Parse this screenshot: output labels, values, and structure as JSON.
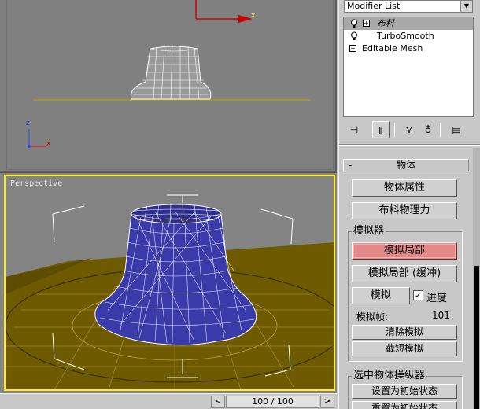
{
  "viewports": {
    "perspective_label": "Perspective",
    "axis_z": "z",
    "axis_x": "x"
  },
  "bottom_bar": {
    "frame_counter": "100 / 100",
    "prev_icon": "<",
    "next_icon": ">"
  },
  "modifier_panel": {
    "modifier_list_label": "Modifier List",
    "stack": [
      {
        "label": "布料",
        "has_bulb": true,
        "has_plus": true,
        "selected": true
      },
      {
        "label": "TurboSmooth",
        "has_bulb": true,
        "has_plus": false,
        "selected": false
      },
      {
        "label": "Editable Mesh",
        "has_bulb": false,
        "has_plus": true,
        "selected": false
      }
    ],
    "rollout_title": "物体",
    "rollout_collapse": "-",
    "object_props_button": "物体属性",
    "cloth_forces_button": "布料物理力",
    "simulation_group_title": "模拟器",
    "simulate_local_button": "模拟局部",
    "simulate_local_damped_button": "模拟局部 (缓冲)",
    "simulate_button": "模拟",
    "progress_label": "进度",
    "progress_checked": true,
    "sim_frame_label": "模拟帧:",
    "sim_frame_value": "101",
    "clear_sim_button": "清除模拟",
    "truncate_sim_button": "截短模拟",
    "selected_object_manip_title": "选中物体操纵器",
    "set_initial_state_button": "设置为初始状态",
    "reset_initial_state_button": "重置为初始状态",
    "checkmark": "✓"
  },
  "colors": {
    "viewport_bg": "#808080",
    "active_border": "#ffec1c",
    "cloth_fill": "#3a3aa8",
    "ground": "#6e5a00",
    "highlight_button": "#e28a8a"
  }
}
